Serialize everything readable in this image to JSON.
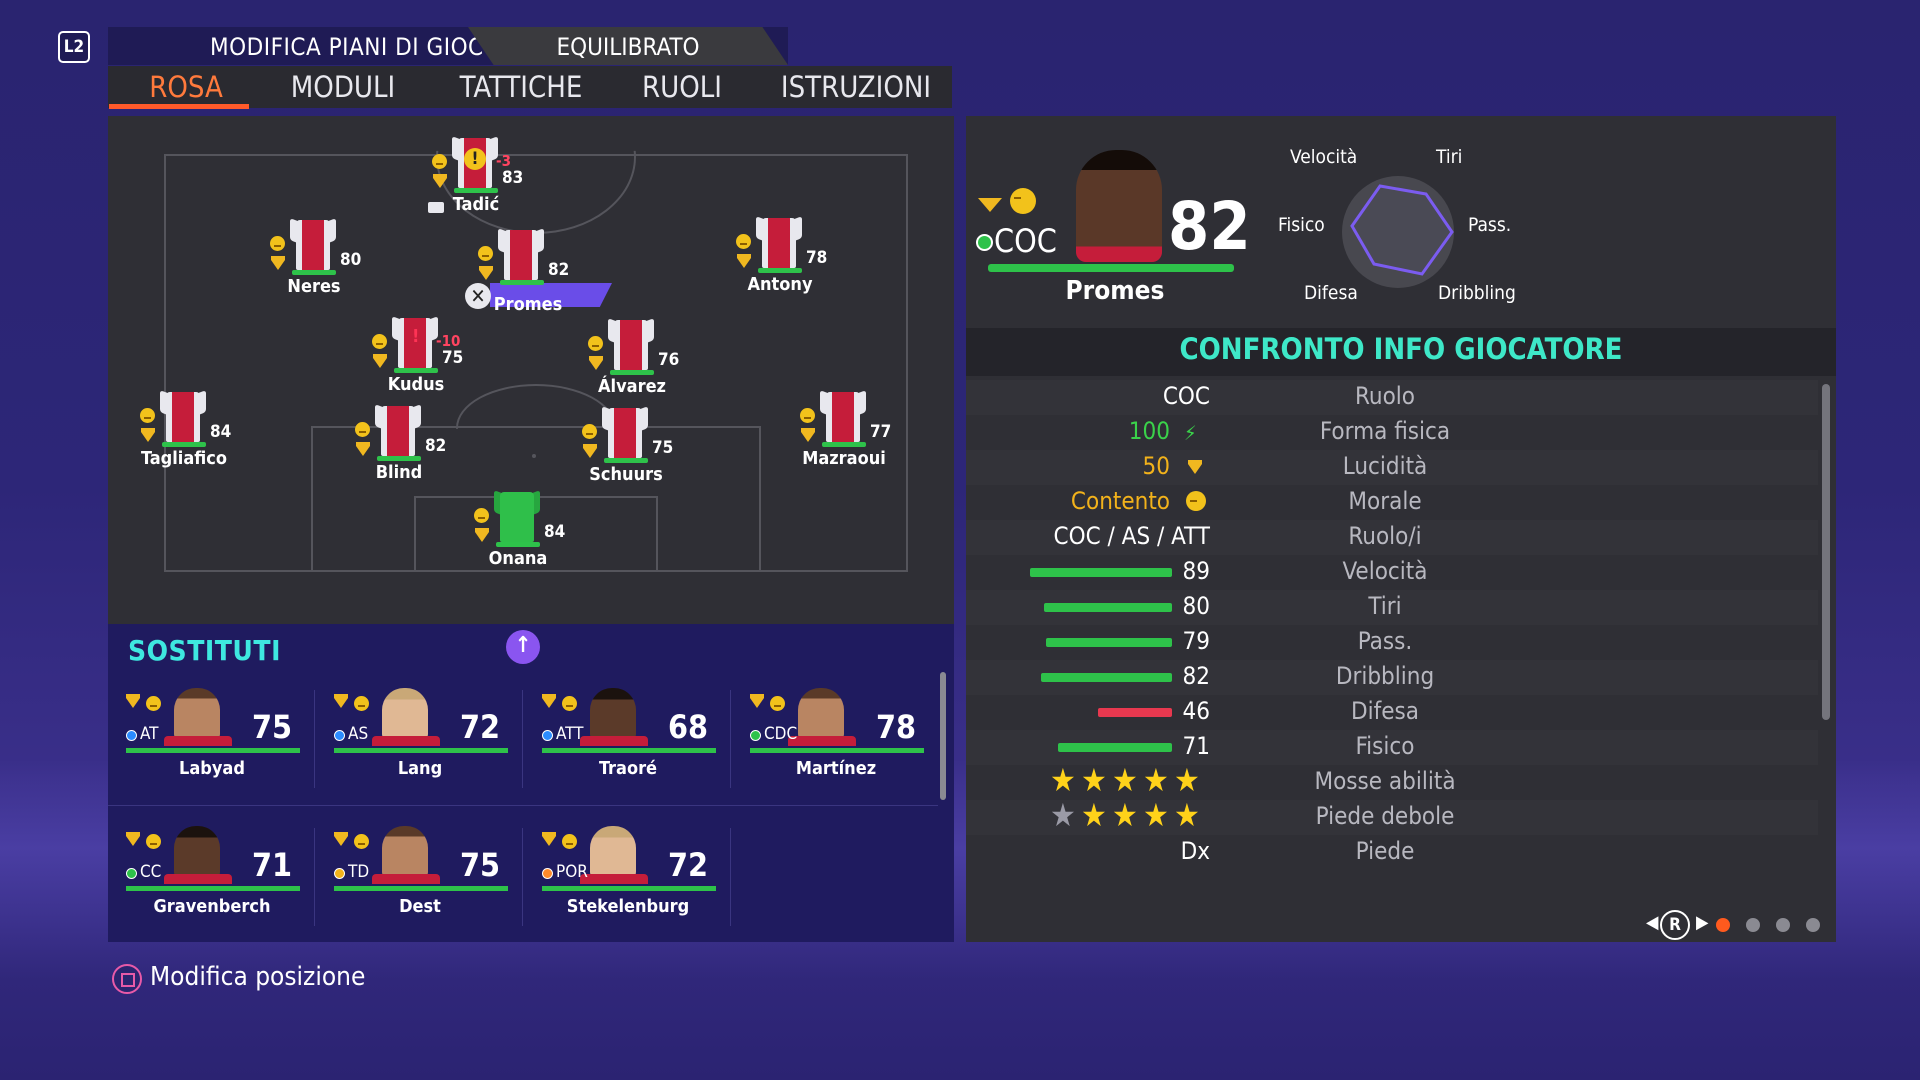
{
  "header": {
    "l2_label": "L2",
    "title": "MODIFICA PIANI DI GIOCO",
    "mode": "EQUILIBRATO"
  },
  "tabs": [
    "ROSA",
    "MODULI",
    "TATTICHE",
    "RUOLI",
    "ISTRUZIONI"
  ],
  "active_tab": "ROSA",
  "pitch_players": [
    {
      "name": "Tadić",
      "rating": "83",
      "badge": "-3",
      "captain": true,
      "warning": "!"
    },
    {
      "name": "Neres",
      "rating": "80"
    },
    {
      "name": "Promes",
      "rating": "82",
      "selected": true
    },
    {
      "name": "Antony",
      "rating": "78"
    },
    {
      "name": "Kudus",
      "rating": "75",
      "badge": "-10",
      "warning": "!"
    },
    {
      "name": "Álvarez",
      "rating": "76"
    },
    {
      "name": "Tagliafico",
      "rating": "84"
    },
    {
      "name": "Blind",
      "rating": "82"
    },
    {
      "name": "Schuurs",
      "rating": "75"
    },
    {
      "name": "Mazraoui",
      "rating": "77"
    },
    {
      "name": "Onana",
      "rating": "84",
      "goalkeeper": true
    }
  ],
  "subs": {
    "title": "SOSTITUTI",
    "players": [
      {
        "name": "Labyad",
        "pos": "AT",
        "rating": "75",
        "dot": "#2b8cff"
      },
      {
        "name": "Lang",
        "pos": "AS",
        "rating": "72",
        "dot": "#2b8cff"
      },
      {
        "name": "Traoré",
        "pos": "ATT",
        "rating": "68",
        "dot": "#2b8cff"
      },
      {
        "name": "Martínez",
        "pos": "CDC",
        "rating": "78",
        "dot": "#2ec24a"
      },
      {
        "name": "Gravenberch",
        "pos": "CC",
        "rating": "71",
        "dot": "#2ec24a"
      },
      {
        "name": "Dest",
        "pos": "TD",
        "rating": "75",
        "dot": "#f2b21b"
      },
      {
        "name": "Stekelenburg",
        "pos": "POR",
        "rating": "72",
        "dot": "#ff8a2a"
      }
    ]
  },
  "card": {
    "position": "COC",
    "rating": "82",
    "name": "Promes",
    "radar_labels": {
      "pace": "Velocità",
      "shooting": "Tiri",
      "physical": "Fisico",
      "passing": "Pass.",
      "defending": "Difesa",
      "dribbling": "Dribbling"
    }
  },
  "compare": {
    "title": "CONFRONTO INFO GIOCATORE",
    "rows": [
      {
        "label": "Ruolo",
        "value": "COC"
      },
      {
        "label": "Forma fisica",
        "value": "100",
        "color": "#3ad24a",
        "icon": "bolt"
      },
      {
        "label": "Lucidità",
        "value": "50",
        "color": "#f2b21b",
        "icon": "gem"
      },
      {
        "label": "Morale",
        "value": "Contento",
        "color": "#f2b21b",
        "icon": "smile"
      },
      {
        "label": "Ruolo/i",
        "value": "COC / AS / ATT"
      },
      {
        "label": "Velocità",
        "value": "89",
        "bar_fraction": 0.89,
        "bar_color": "#2ec24a"
      },
      {
        "label": "Tiri",
        "value": "80",
        "bar_fraction": 0.8,
        "bar_color": "#2ec24a"
      },
      {
        "label": "Pass.",
        "value": "79",
        "bar_fraction": 0.79,
        "bar_color": "#2ec24a"
      },
      {
        "label": "Dribbling",
        "value": "82",
        "bar_fraction": 0.82,
        "bar_color": "#2ec24a"
      },
      {
        "label": "Difesa",
        "value": "46",
        "bar_fraction": 0.46,
        "bar_color": "#e8384f"
      },
      {
        "label": "Fisico",
        "value": "71",
        "bar_fraction": 0.71,
        "bar_color": "#2ec24a"
      },
      {
        "label": "Mosse abilità",
        "stars": 5
      },
      {
        "label": "Piede debole",
        "stars": 4
      },
      {
        "label": "Piede",
        "value": "Dx"
      }
    ]
  },
  "pager": {
    "button": "R",
    "pages": 4,
    "current": 1
  },
  "footer": {
    "label": "Modifica posizione"
  }
}
